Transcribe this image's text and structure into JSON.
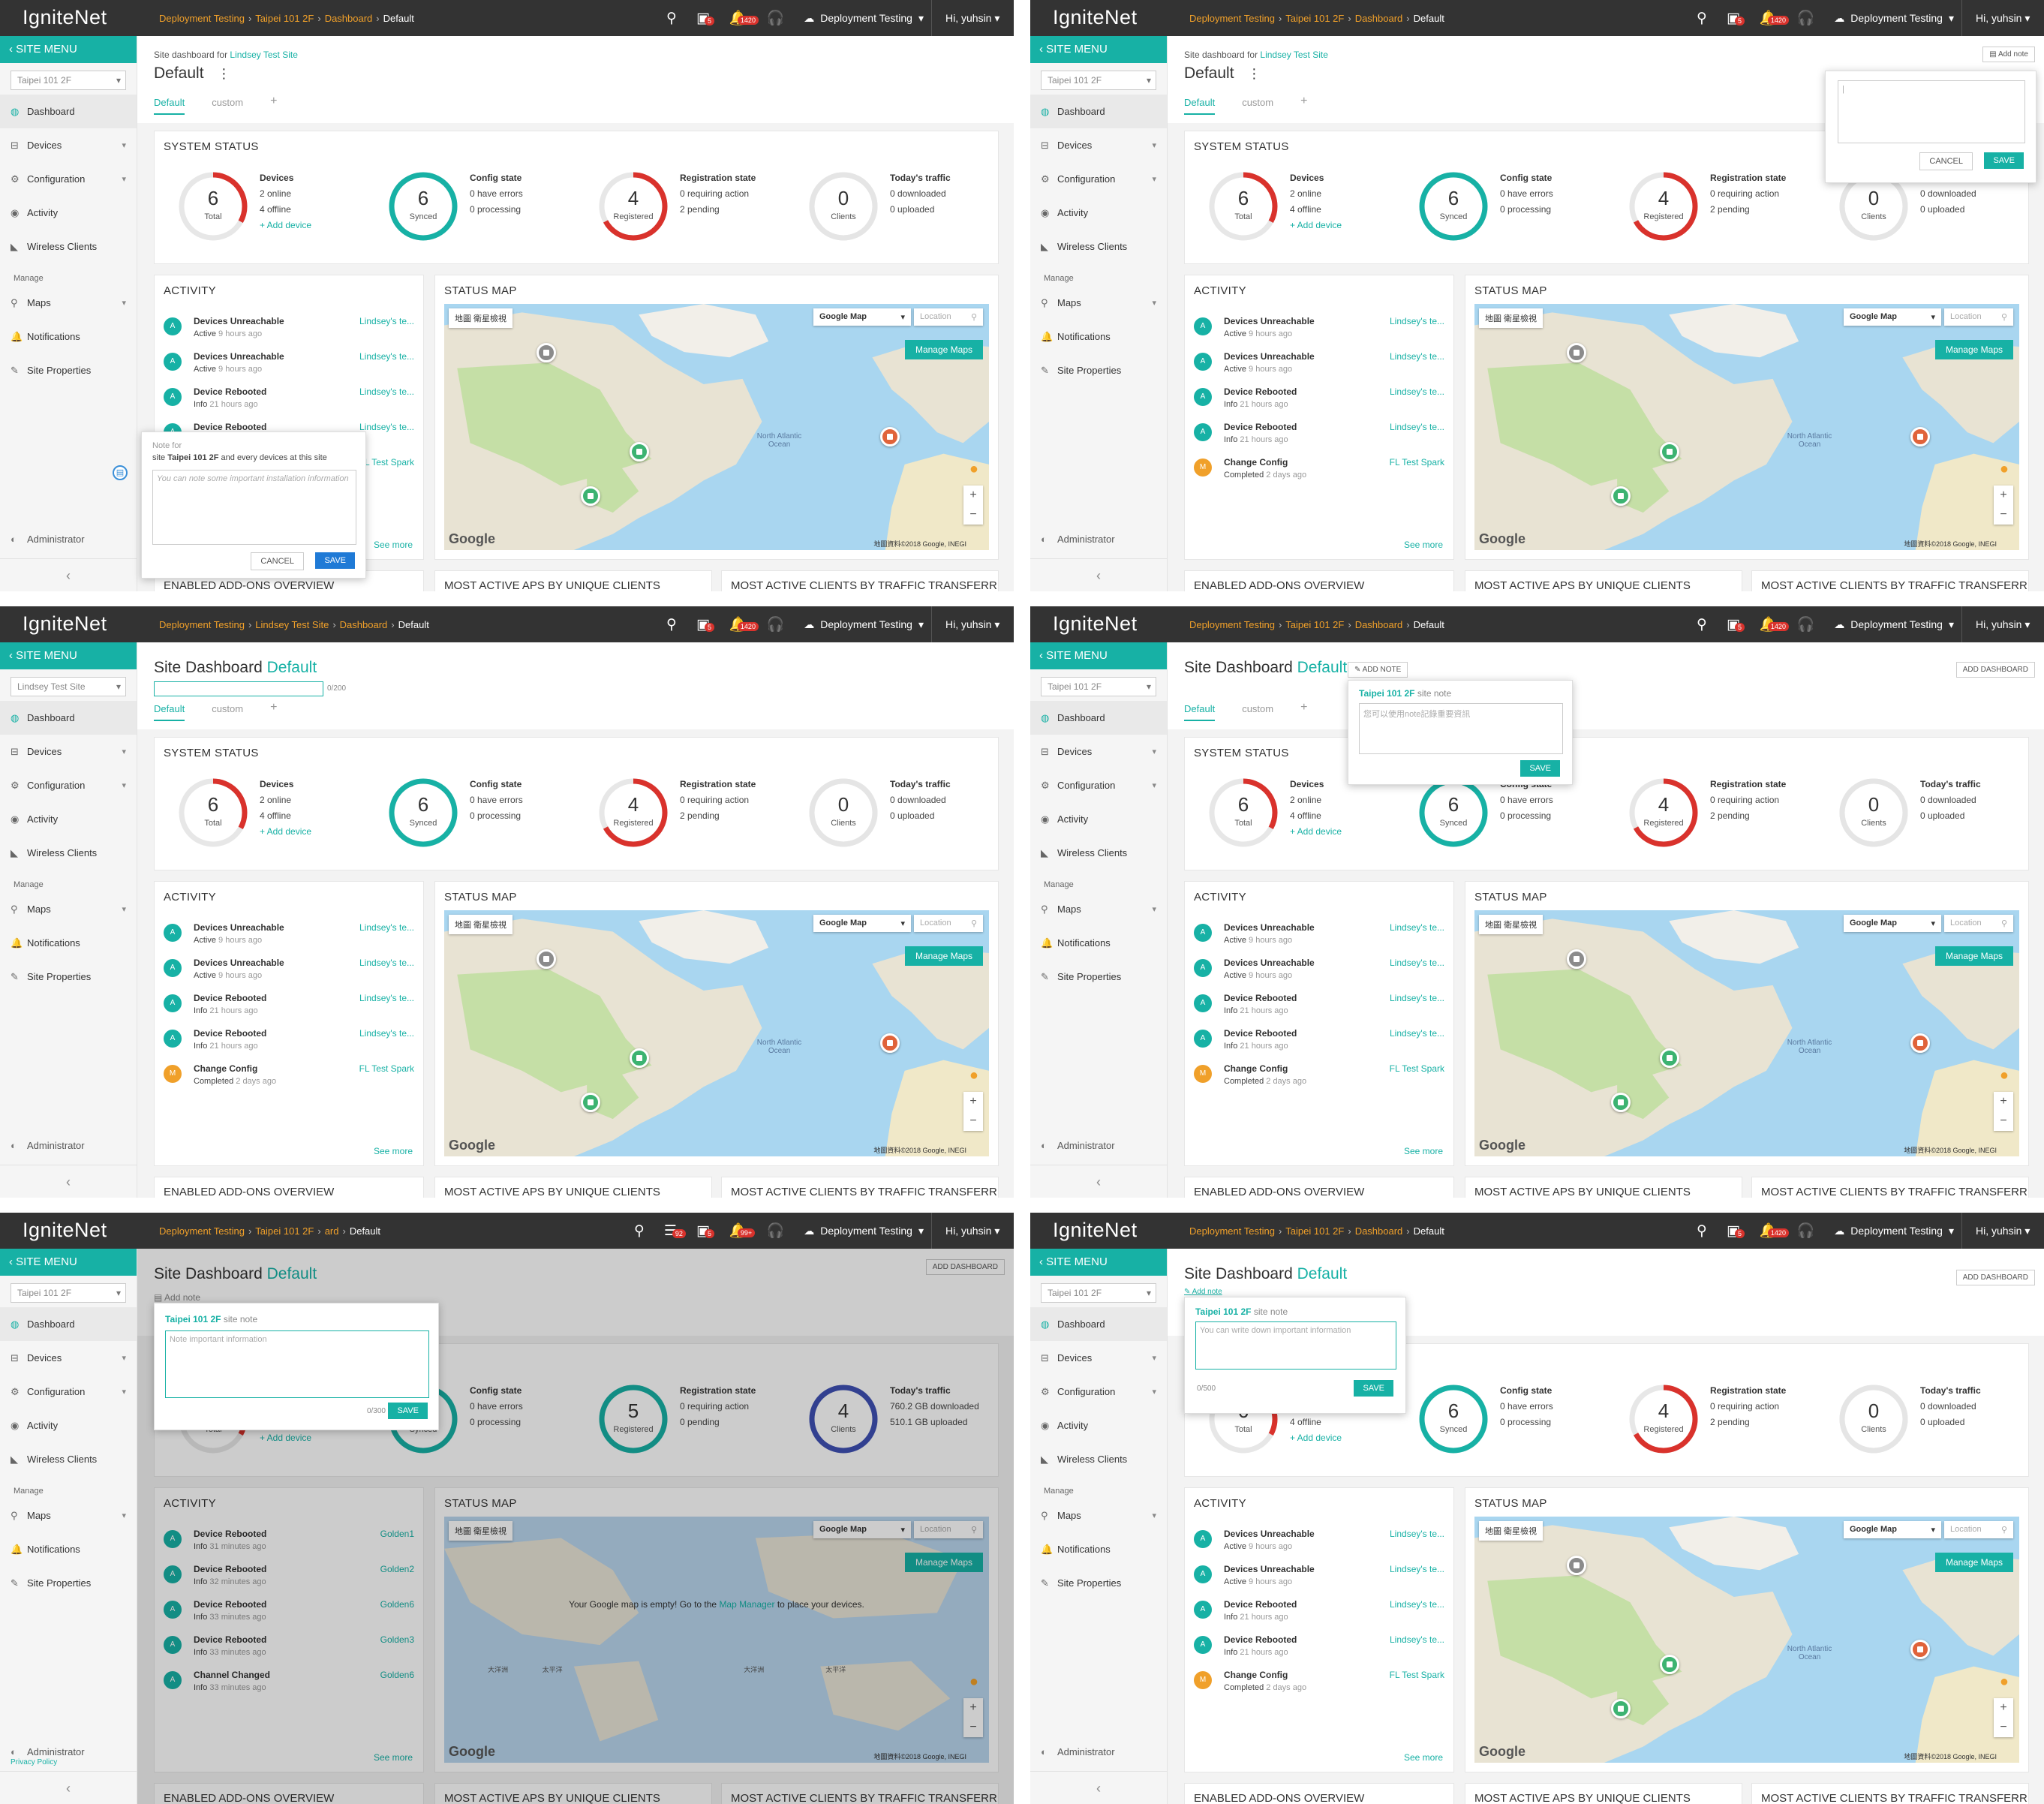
{
  "app": {
    "logo": "IgniteNet",
    "org": "Deployment Testing",
    "user": "Hi, yuhsin",
    "site_menu": "SITE MENU",
    "nav": [
      "Dashboard",
      "Devices",
      "Configuration",
      "Activity",
      "Wireless Clients"
    ],
    "manage_label": "Manage",
    "manage_nav": [
      "Maps",
      "Notifications",
      "Site Properties"
    ],
    "admin": "Administrator",
    "privacy": "Privacy Policy",
    "tabs": [
      "Default",
      "custom",
      "+"
    ],
    "cards": {
      "system_status": "SYSTEM STATUS",
      "activity": "ACTIVITY",
      "status_map": "STATUS MAP",
      "addons": "ENABLED ADD-ONS OVERVIEW",
      "active_aps": "MOST ACTIVE APS BY UNIQUE CLIENTS",
      "active_clients": "MOST ACTIVE CLIENTS BY TRAFFIC TRANSFERR..."
    },
    "gauges": {
      "devices": {
        "title": "Devices",
        "num": "6",
        "label": "Total",
        "l1": "2 online",
        "l2": "4 offline",
        "link": "+ Add device"
      },
      "config": {
        "title": "Config state",
        "num": "6",
        "label": "Synced",
        "l1": "0 have errors",
        "l2": "0 processing"
      },
      "registration": {
        "title": "Registration state",
        "num": "4",
        "label": "Registered",
        "l1": "0 requiring action",
        "l2": "2 pending"
      },
      "traffic": {
        "title": "Today's traffic",
        "num": "0",
        "label": "Clients",
        "l1": "0 downloaded",
        "l2": "0 uploaded"
      }
    },
    "activity": [
      {
        "title": "Devices Unreachable",
        "status": "Active",
        "time": "9 hours ago",
        "link": "Lindsey's te...",
        "avatar": "A"
      },
      {
        "title": "Devices Unreachable",
        "status": "Active",
        "time": "9 hours ago",
        "link": "Lindsey's te...",
        "avatar": "A"
      },
      {
        "title": "Device Rebooted",
        "status": "Info",
        "time": "21 hours ago",
        "link": "Lindsey's te...",
        "avatar": "A"
      },
      {
        "title": "Device Rebooted",
        "status": "Info",
        "time": "21 hours ago",
        "link": "Lindsey's te...",
        "avatar": "A"
      },
      {
        "title": "Change Config",
        "status": "Completed",
        "time": "2 days ago",
        "link": "FL Test Spark",
        "avatar": "M"
      }
    ],
    "see_more": "See more",
    "map": {
      "type_tabs": "地圖  衛星檢視",
      "map_select": "Google Map",
      "location_placeholder": "Location",
      "manage_maps": "Manage Maps",
      "google": "Google",
      "copyright": "地圖資料©2018 Google, INEGI",
      "ocean": "North Atlantic Ocean"
    }
  },
  "panels": [
    {
      "breadcrumb": [
        "Deployment Testing",
        "Taipei 101 2F",
        "Dashboard",
        "Default"
      ],
      "site": "Taipei 101 2F",
      "title_prefix": "",
      "title": "Default",
      "subtitle": "Site dashboard for",
      "subtitle_link": "Lindsey Test Site",
      "note": {
        "head": "Note for",
        "line2a": "site",
        "line2b": "Taipei 101 2F",
        "line2c": "and every devices at this site",
        "placeholder": "You can note some important installation information",
        "cancel": "CANCEL",
        "save": "SAVE"
      }
    },
    {
      "breadcrumb": [
        "Deployment Testing",
        "Taipei 101 2F",
        "Dashboard",
        "Default"
      ],
      "site": "Taipei 101 2F",
      "title": "Default",
      "subtitle": "Site dashboard for",
      "subtitle_link": "Lindsey Test Site",
      "add_note": "Add note",
      "note": {
        "cancel": "CANCEL",
        "save": "SAVE"
      }
    },
    {
      "breadcrumb": [
        "Deployment Testing",
        "Lindsey Test Site",
        "Dashboard",
        "Default"
      ],
      "site": "Lindsey Test Site",
      "title_prefix": "Site Dashboard",
      "title": "Default",
      "counter": "0/200"
    },
    {
      "breadcrumb": [
        "Deployment Testing",
        "Taipei 101 2F",
        "Dashboard",
        "Default"
      ],
      "site": "Taipei 101 2F",
      "title_prefix": "Site Dashboard",
      "title": "Default",
      "add_note": "✎ ADD NOTE",
      "add_dashboard": "ADD DASHBOARD",
      "note": {
        "head": "Taipei 101 2F",
        "sub": "site note",
        "placeholder": "您可以使用note記錄重要資訊",
        "save": "SAVE"
      }
    },
    {
      "breadcrumb": [
        "Deployment Testing",
        "Taipei 101 2F",
        "ard",
        "Default"
      ],
      "site": "Taipei 101 2F",
      "title_prefix": "Site Dashboard",
      "title": "Default",
      "add_note": "Add note",
      "add_dashboard": "ADD DASHBOARD",
      "badges": [
        "92",
        "5",
        "99+"
      ],
      "note": {
        "head": "Taipei 101 2F",
        "sub": "site note",
        "placeholder": "Note important information",
        "counter": "0/300",
        "save": "SAVE"
      },
      "gauges": {
        "config": {
          "title": "Config state",
          "l1": "0 have errors",
          "l2": "0 processing"
        },
        "registration": {
          "title": "Registration state",
          "num": "5",
          "label": "Registered",
          "l1": "0 requiring action",
          "l2": "0 pending"
        },
        "traffic": {
          "title": "Today's traffic",
          "num": "4",
          "label": "Clients",
          "l1": "760.2 GB downloaded",
          "l2": "510.1 GB uploaded"
        },
        "devices_link": "+ Add device"
      },
      "activity": [
        {
          "title": "Device Rebooted",
          "status": "Info",
          "time": "31 minutes ago",
          "link": "Golden1"
        },
        {
          "title": "Device Rebooted",
          "status": "Info",
          "time": "32 minutes ago",
          "link": "Golden2"
        },
        {
          "title": "Device Rebooted",
          "status": "Info",
          "time": "33 minutes ago",
          "link": "Golden6"
        },
        {
          "title": "Device Rebooted",
          "status": "Info",
          "time": "33 minutes ago",
          "link": "Golden3"
        },
        {
          "title": "Channel Changed",
          "status": "Info",
          "time": "33 minutes ago",
          "link": "Golden6"
        }
      ],
      "map_empty_a": "Your Google map is empty! Go to the",
      "map_empty_link": "Map Manager",
      "map_empty_b": "to place your devices.",
      "world_labels": [
        "大洋洲",
        "太平洋",
        "大洋洲",
        "太平洋"
      ]
    },
    {
      "breadcrumb": [
        "Deployment Testing",
        "Taipei 101 2F",
        "Dashboard",
        "Default"
      ],
      "site": "Taipei 101 2F",
      "title_prefix": "Site Dashboard",
      "title": "Default",
      "add_note": "Add note",
      "add_dashboard": "ADD DASHBOARD",
      "note": {
        "head": "Taipei 101 2F",
        "sub": "site note",
        "placeholder": "You can write down important information",
        "counter": "0/500",
        "save": "SAVE"
      }
    }
  ],
  "colors": {
    "accent": "#17b1a5",
    "topbar": "#333333",
    "red": "#d9322c",
    "orange": "#f0a02a"
  }
}
